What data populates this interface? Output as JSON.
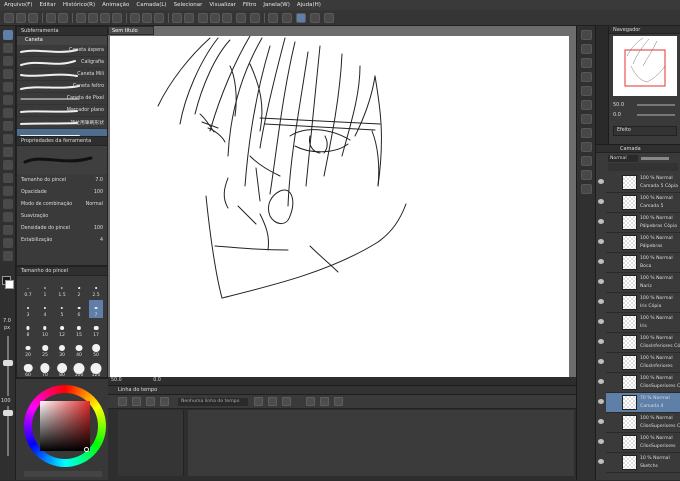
{
  "menu": [
    "Arquivo(F)",
    "Editar",
    "Histórico(R)",
    "Animação",
    "Camada(L)",
    "Selecionar",
    "Visualizar",
    "Filtro",
    "Janela(W)",
    "Ajuda(H)"
  ],
  "subtool": {
    "title": "Subferramenta",
    "tab": "Caneta",
    "brushes": [
      "Caneta áspera",
      "Caligrafia",
      "Caneta Mili",
      "Caneta feltro",
      "Caneta de Pixel",
      "Marcador plano",
      "持仕用筆刷形状",
      ""
    ]
  },
  "tool_property": {
    "title": "Propriedades da ferramenta",
    "rows": [
      {
        "label": "Tamanho do pincel",
        "value": "7.0"
      },
      {
        "label": "Opacidade",
        "value": "100"
      },
      {
        "label": "Modo de combinação",
        "value": "Normal"
      },
      {
        "label": "Suavização",
        "value": ""
      },
      {
        "label": "Densidade do pincel",
        "value": "100"
      },
      {
        "label": "Estabilização",
        "value": "4"
      }
    ]
  },
  "brush_size": {
    "title": "Tamanho do pincel",
    "sizes": [
      "0.7",
      "1",
      "1.5",
      "2",
      "2.5",
      "3",
      "4",
      "5",
      "6",
      "7",
      "8",
      "10",
      "12",
      "15",
      "17",
      "20",
      "25",
      "30",
      "40",
      "50",
      "60",
      "70",
      "80",
      "100",
      "120"
    ],
    "current": "7.0",
    "unit": "px"
  },
  "canvas": {
    "tab": "Sem título",
    "zoom": "50.0",
    "angle": "0.0"
  },
  "timeline": {
    "title": "Linha do tempo",
    "track": "Nenhuma linha do tempo"
  },
  "navigator": {
    "title": "Navegador",
    "zoom": "50.0",
    "angle": "0.0"
  },
  "layer_panel": {
    "tabs": [
      "Camada",
      "Efeito"
    ],
    "blend": "Normal",
    "opacity": "100",
    "layers": [
      {
        "pct": "100 %",
        "mode": "Normal",
        "name": "Camada 5 Cópia"
      },
      {
        "pct": "100 %",
        "mode": "Normal",
        "name": "Camada 5"
      },
      {
        "pct": "100 %",
        "mode": "Normal",
        "name": "Pálpebras Cópia"
      },
      {
        "pct": "100 %",
        "mode": "Normal",
        "name": "Pálpebras"
      },
      {
        "pct": "100 %",
        "mode": "Normal",
        "name": "Boca"
      },
      {
        "pct": "100 %",
        "mode": "Normal",
        "name": "Nariz"
      },
      {
        "pct": "100 %",
        "mode": "Normal",
        "name": "Iris Cópia"
      },
      {
        "pct": "100 %",
        "mode": "Normal",
        "name": "Iris"
      },
      {
        "pct": "100 %",
        "mode": "Normal",
        "name": "CílosInferiores Cópia"
      },
      {
        "pct": "100 %",
        "mode": "Normal",
        "name": "CílosInferiores"
      },
      {
        "pct": "100 %",
        "mode": "Normal",
        "name": "CílosSuperiores Cópia"
      },
      {
        "pct": "70 %",
        "mode": "Normal",
        "name": "Camada 4",
        "selected": true
      },
      {
        "pct": "100 %",
        "mode": "Normal",
        "name": "CílosSuperiores Cópia"
      },
      {
        "pct": "100 %",
        "mode": "Normal",
        "name": "CílosSuperiores"
      },
      {
        "pct": "10 %",
        "mode": "Normal",
        "name": "Sketchs"
      }
    ]
  },
  "colors": {
    "main": "#1a1a1a",
    "sub": "#ffffff",
    "selection": "#5d7fa8"
  }
}
